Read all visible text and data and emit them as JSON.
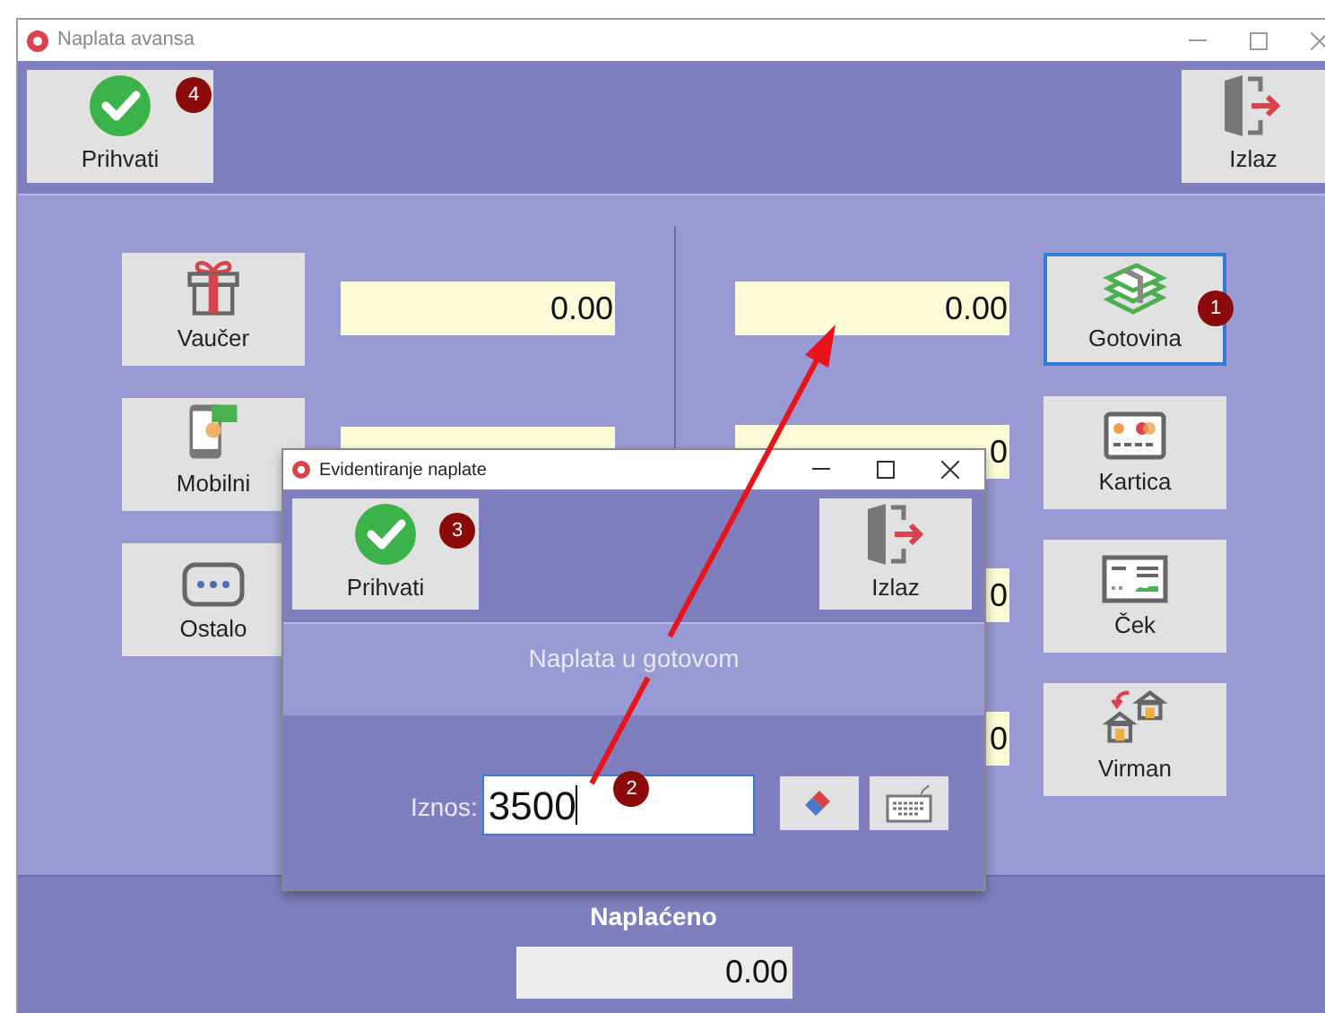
{
  "window": {
    "title": "Naplata avansa"
  },
  "toolbar": {
    "buttons": [
      {
        "label": "Prihvati",
        "kind": "accept",
        "badge": "4"
      },
      {
        "label": "Izlaz",
        "kind": "exit"
      }
    ]
  },
  "left_methods": [
    {
      "label": "Vaučer",
      "kind": "voucher",
      "amount": "0.00"
    },
    {
      "label": "Mobilni",
      "kind": "mobile"
    },
    {
      "label": "Ostalo",
      "kind": "other"
    }
  ],
  "right_methods": [
    {
      "label": "Gotovina",
      "kind": "cash",
      "amount": "0.00",
      "selected": true,
      "badge": "1"
    },
    {
      "label": "Kartica",
      "kind": "card",
      "amount": "0",
      "selected": false
    },
    {
      "label": "Ček",
      "kind": "cheque",
      "amount": "0",
      "selected": false
    },
    {
      "label": "Virman",
      "kind": "transfer",
      "amount": "0",
      "selected": false
    }
  ],
  "footer": {
    "label": "Naplaćeno",
    "amount": "0.00"
  },
  "dialog": {
    "title": "Evidentiranje naplate",
    "toolbar": {
      "buttons": [
        {
          "label": "Prihvati",
          "kind": "accept",
          "badge": "3"
        },
        {
          "label": "Izlaz",
          "kind": "exit"
        }
      ]
    },
    "subtitle": "Naplata u gotovom",
    "amount_label": "Iznos:",
    "amount_value": "3500",
    "amount_badge": "2",
    "tools": [
      {
        "kind": "eraser"
      },
      {
        "kind": "keyboard"
      }
    ]
  }
}
